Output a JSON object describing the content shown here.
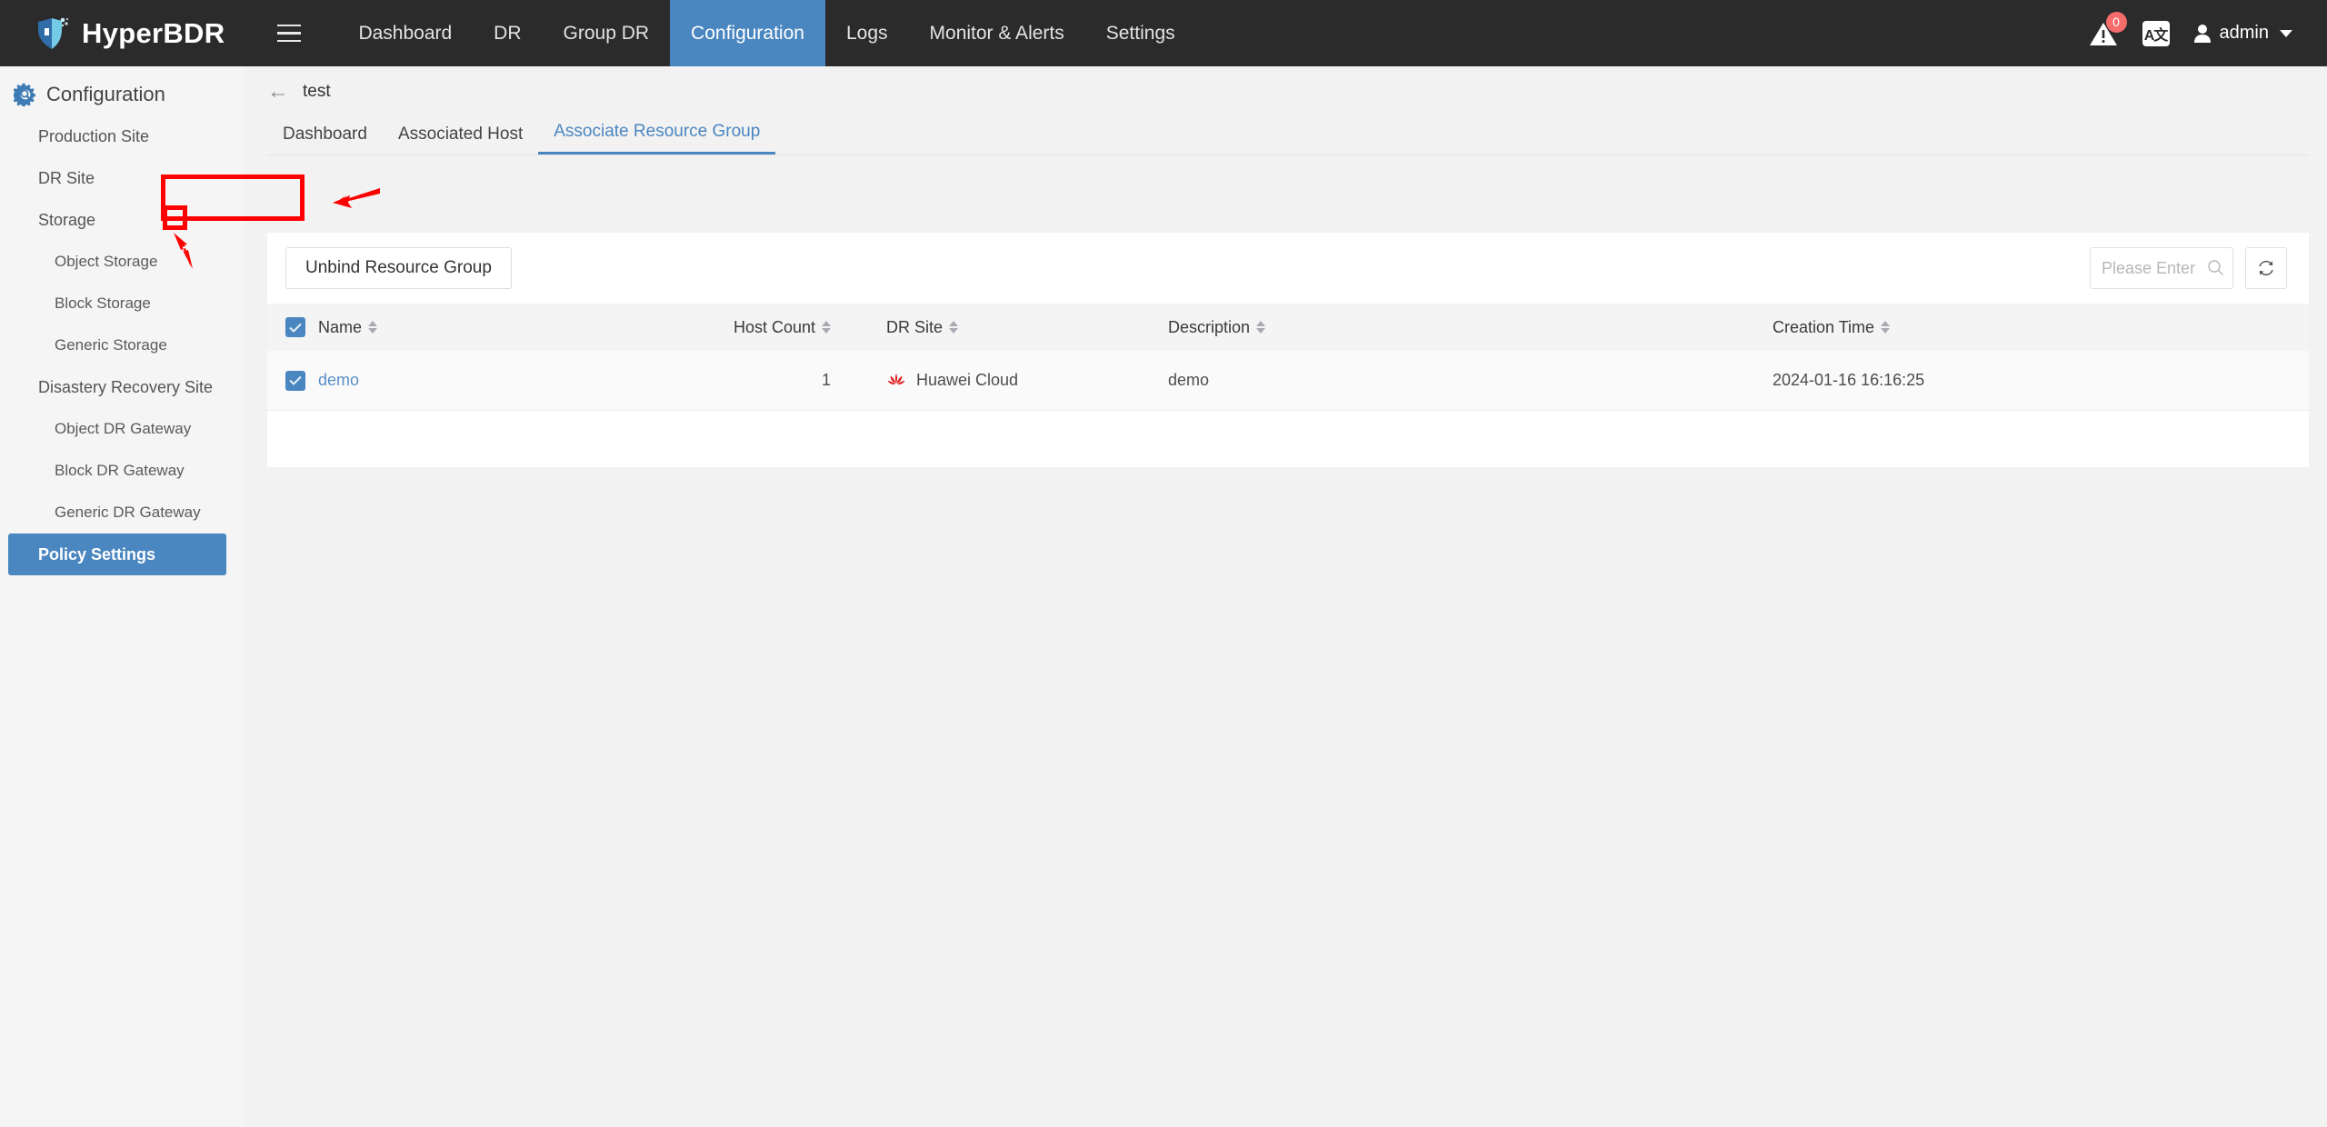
{
  "topbar": {
    "brand": "HyperBDR",
    "menu_icon": "hamburger-icon",
    "nav": [
      {
        "label": "Dashboard",
        "active": false
      },
      {
        "label": "DR",
        "active": false
      },
      {
        "label": "Group DR",
        "active": false
      },
      {
        "label": "Configuration",
        "active": true
      },
      {
        "label": "Logs",
        "active": false
      },
      {
        "label": "Monitor & Alerts",
        "active": false
      },
      {
        "label": "Settings",
        "active": false
      }
    ],
    "alert_badge": "0",
    "lang_label": "A文",
    "user": "admin",
    "accent": "#4a86c0",
    "bar_bg": "#2b2b2b"
  },
  "sidebar": {
    "title": "Configuration",
    "items": [
      {
        "label": "Production Site",
        "level": 1,
        "active": false
      },
      {
        "label": "DR Site",
        "level": 1,
        "active": false
      },
      {
        "label": "Storage",
        "level": 1,
        "active": false
      },
      {
        "label": "Object Storage",
        "level": 2,
        "active": false
      },
      {
        "label": "Block Storage",
        "level": 2,
        "active": false
      },
      {
        "label": "Generic Storage",
        "level": 2,
        "active": false
      },
      {
        "label": "Disastery Recovery Site",
        "level": 1,
        "active": false
      },
      {
        "label": "Object DR Gateway",
        "level": 2,
        "active": false
      },
      {
        "label": "Block DR Gateway",
        "level": 2,
        "active": false
      },
      {
        "label": "Generic DR Gateway",
        "level": 2,
        "active": false
      },
      {
        "label": "Policy Settings",
        "level": 1,
        "active": true
      }
    ]
  },
  "breadcrumb": {
    "back_icon": "back-arrow-icon",
    "title": "test"
  },
  "tabs": [
    {
      "label": "Dashboard",
      "active": false
    },
    {
      "label": "Associated Host",
      "active": false
    },
    {
      "label": "Associate Resource Group",
      "active": true
    }
  ],
  "toolbar": {
    "unbind_label": "Unbind Resource Group",
    "search_placeholder": "Please Enter",
    "search_value": "",
    "search_icon": "search-icon",
    "refresh_icon": "refresh-icon"
  },
  "table": {
    "columns": [
      {
        "label": "Name",
        "sortable": true
      },
      {
        "label": "Host Count",
        "sortable": true
      },
      {
        "label": "DR Site",
        "sortable": true
      },
      {
        "label": "Description",
        "sortable": true
      },
      {
        "label": "Creation Time",
        "sortable": true
      }
    ],
    "header_checkbox_checked": true,
    "rows": [
      {
        "checked": true,
        "name": "demo",
        "host_count": "1",
        "dr_site": "Huawei Cloud",
        "dr_site_icon": "huawei-cloud-icon",
        "description": "demo",
        "creation_time": "2024-01-16 16:16:25"
      }
    ]
  },
  "annotations": {
    "highlight_color": "#fe0000",
    "boxes": [
      "unbind-resource-group-button",
      "row-checkbox"
    ],
    "arrows": [
      "arrow-to-unbind-button",
      "arrow-to-row-checkbox"
    ]
  }
}
